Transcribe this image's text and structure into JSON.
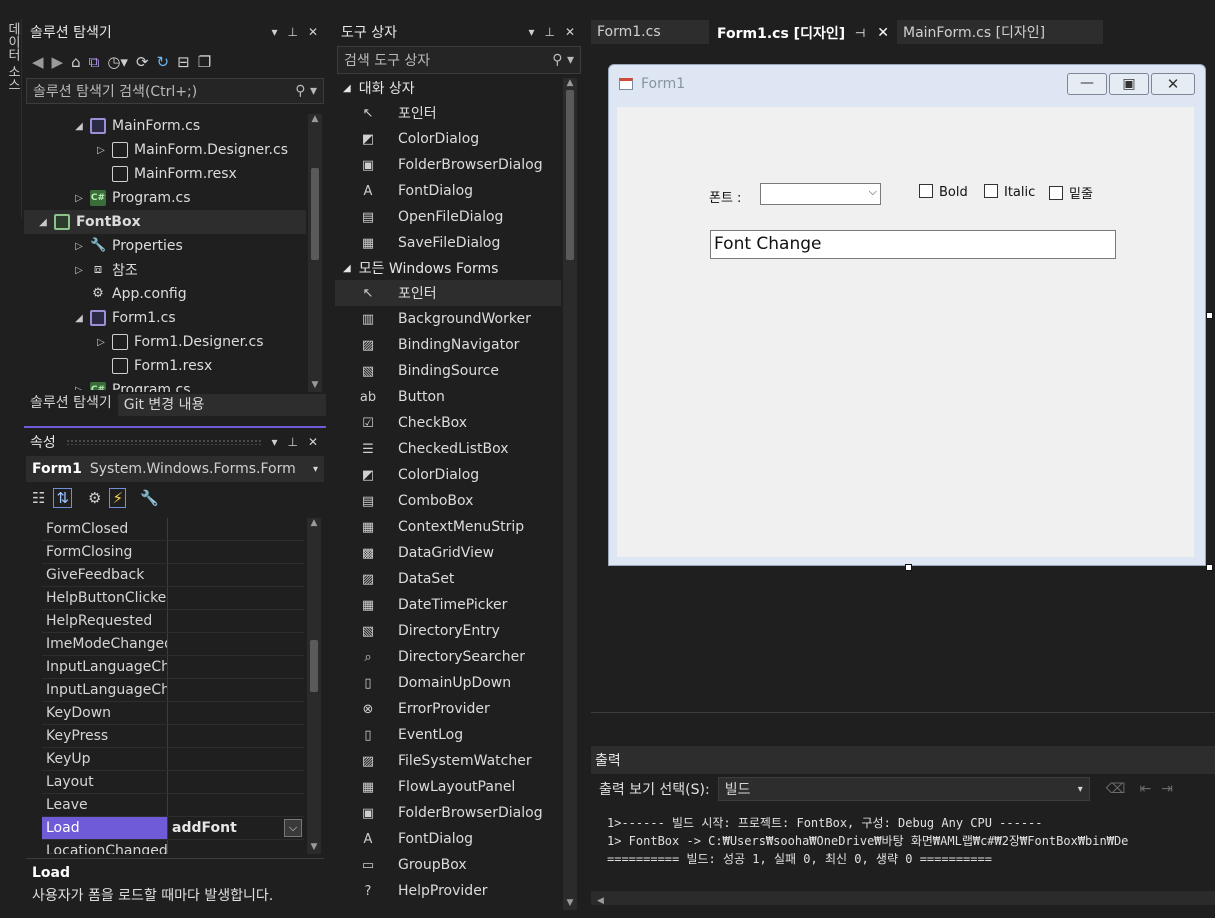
{
  "vertical_tab": {
    "label": "데이터 소스"
  },
  "solution_explorer": {
    "title": "솔루션 탐색기",
    "search_placeholder": "솔루션 탐색기 검색(Ctrl+;)",
    "tree": [
      {
        "label": "MainForm.cs",
        "indent": 1,
        "expander": "▲",
        "icon": "form"
      },
      {
        "label": "MainForm.Designer.cs",
        "indent": 2,
        "expander": "▷",
        "icon": "file"
      },
      {
        "label": "MainForm.resx",
        "indent": 2,
        "expander": "",
        "icon": "file"
      },
      {
        "label": "Program.cs",
        "indent": 1,
        "expander": "▷",
        "icon": "cs"
      },
      {
        "label": "FontBox",
        "indent": 0,
        "expander": "▲",
        "icon": "proj"
      },
      {
        "label": "Properties",
        "indent": 1,
        "expander": "▷",
        "icon": "wrench"
      },
      {
        "label": "참조",
        "indent": 1,
        "expander": "▷",
        "icon": "ref"
      },
      {
        "label": "App.config",
        "indent": 1,
        "expander": "",
        "icon": "config"
      },
      {
        "label": "Form1.cs",
        "indent": 1,
        "expander": "▲",
        "icon": "form"
      },
      {
        "label": "Form1.Designer.cs",
        "indent": 2,
        "expander": "▷",
        "icon": "file"
      },
      {
        "label": "Form1.resx",
        "indent": 2,
        "expander": "",
        "icon": "file"
      },
      {
        "label": "Program.cs",
        "indent": 1,
        "expander": "▷",
        "icon": "cs"
      }
    ],
    "bottom_tabs": [
      "솔루션 탐색기",
      "Git 변경 내용"
    ]
  },
  "properties": {
    "title": "속성",
    "object_name": "Form1",
    "object_type": "System.Windows.Forms.Form",
    "rows": [
      {
        "name": "FormClosed",
        "value": ""
      },
      {
        "name": "FormClosing",
        "value": ""
      },
      {
        "name": "GiveFeedback",
        "value": ""
      },
      {
        "name": "HelpButtonClicked",
        "value": ""
      },
      {
        "name": "HelpRequested",
        "value": ""
      },
      {
        "name": "ImeModeChanged",
        "value": ""
      },
      {
        "name": "InputLanguageChanged",
        "value": ""
      },
      {
        "name": "InputLanguageChanging",
        "value": ""
      },
      {
        "name": "KeyDown",
        "value": ""
      },
      {
        "name": "KeyPress",
        "value": ""
      },
      {
        "name": "KeyUp",
        "value": ""
      },
      {
        "name": "Layout",
        "value": ""
      },
      {
        "name": "Leave",
        "value": ""
      },
      {
        "name": "Load",
        "value": "addFont"
      },
      {
        "name": "LocationChanged",
        "value": ""
      }
    ],
    "desc_title": "Load",
    "desc_text": "사용자가 폼을 로드할 때마다 발생합니다."
  },
  "toolbox": {
    "title": "도구 상자",
    "search_placeholder": "검색 도구 상자",
    "categories": [
      {
        "label": "대화 상자",
        "items": [
          {
            "label": "포인터",
            "icon": "↖"
          },
          {
            "label": "ColorDialog",
            "icon": "◩"
          },
          {
            "label": "FolderBrowserDialog",
            "icon": "▣"
          },
          {
            "label": "FontDialog",
            "icon": "A"
          },
          {
            "label": "OpenFileDialog",
            "icon": "▤"
          },
          {
            "label": "SaveFileDialog",
            "icon": "▦"
          }
        ]
      },
      {
        "label": "모든 Windows Forms",
        "items": [
          {
            "label": "포인터",
            "icon": "↖"
          },
          {
            "label": "BackgroundWorker",
            "icon": "▥"
          },
          {
            "label": "BindingNavigator",
            "icon": "▨"
          },
          {
            "label": "BindingSource",
            "icon": "▧"
          },
          {
            "label": "Button",
            "icon": "ab"
          },
          {
            "label": "CheckBox",
            "icon": "☑"
          },
          {
            "label": "CheckedListBox",
            "icon": "☰"
          },
          {
            "label": "ColorDialog",
            "icon": "◩"
          },
          {
            "label": "ComboBox",
            "icon": "▤"
          },
          {
            "label": "ContextMenuStrip",
            "icon": "▦"
          },
          {
            "label": "DataGridView",
            "icon": "▩"
          },
          {
            "label": "DataSet",
            "icon": "▨"
          },
          {
            "label": "DateTimePicker",
            "icon": "▦"
          },
          {
            "label": "DirectoryEntry",
            "icon": "▧"
          },
          {
            "label": "DirectorySearcher",
            "icon": "⌕"
          },
          {
            "label": "DomainUpDown",
            "icon": "▯"
          },
          {
            "label": "ErrorProvider",
            "icon": "⊗"
          },
          {
            "label": "EventLog",
            "icon": "▯"
          },
          {
            "label": "FileSystemWatcher",
            "icon": "▨"
          },
          {
            "label": "FlowLayoutPanel",
            "icon": "▦"
          },
          {
            "label": "FolderBrowserDialog",
            "icon": "▣"
          },
          {
            "label": "FontDialog",
            "icon": "A"
          },
          {
            "label": "GroupBox",
            "icon": "▭"
          },
          {
            "label": "HelpProvider",
            "icon": "?"
          }
        ]
      }
    ]
  },
  "doc_tabs": [
    {
      "label": "Form1.cs",
      "active": false
    },
    {
      "label": "Form1.cs [디자인]",
      "active": true
    },
    {
      "label": "MainForm.cs [디자인]",
      "active": false
    }
  ],
  "designer_form": {
    "title": "Form1",
    "font_label": "폰트 :",
    "font_combo_value": "",
    "bold_label": "Bold",
    "italic_label": "Italic",
    "underline_label": "밑줄",
    "textbox_value": "Font Change"
  },
  "output": {
    "title": "출력",
    "source_label": "출력 보기 선택(S):",
    "source_value": "빌드",
    "lines": [
      "1>------ 빌드 시작: 프로젝트: FontBox, 구성: Debug Any CPU ------",
      "1>  FontBox -> C:₩Users₩sooha₩OneDrive₩바탕 화면₩AML랩₩c#₩2장₩FontBox₩bin₩De",
      "========== 빌드: 성공 1, 실패 0, 최신 0, 생략 0 =========="
    ]
  }
}
